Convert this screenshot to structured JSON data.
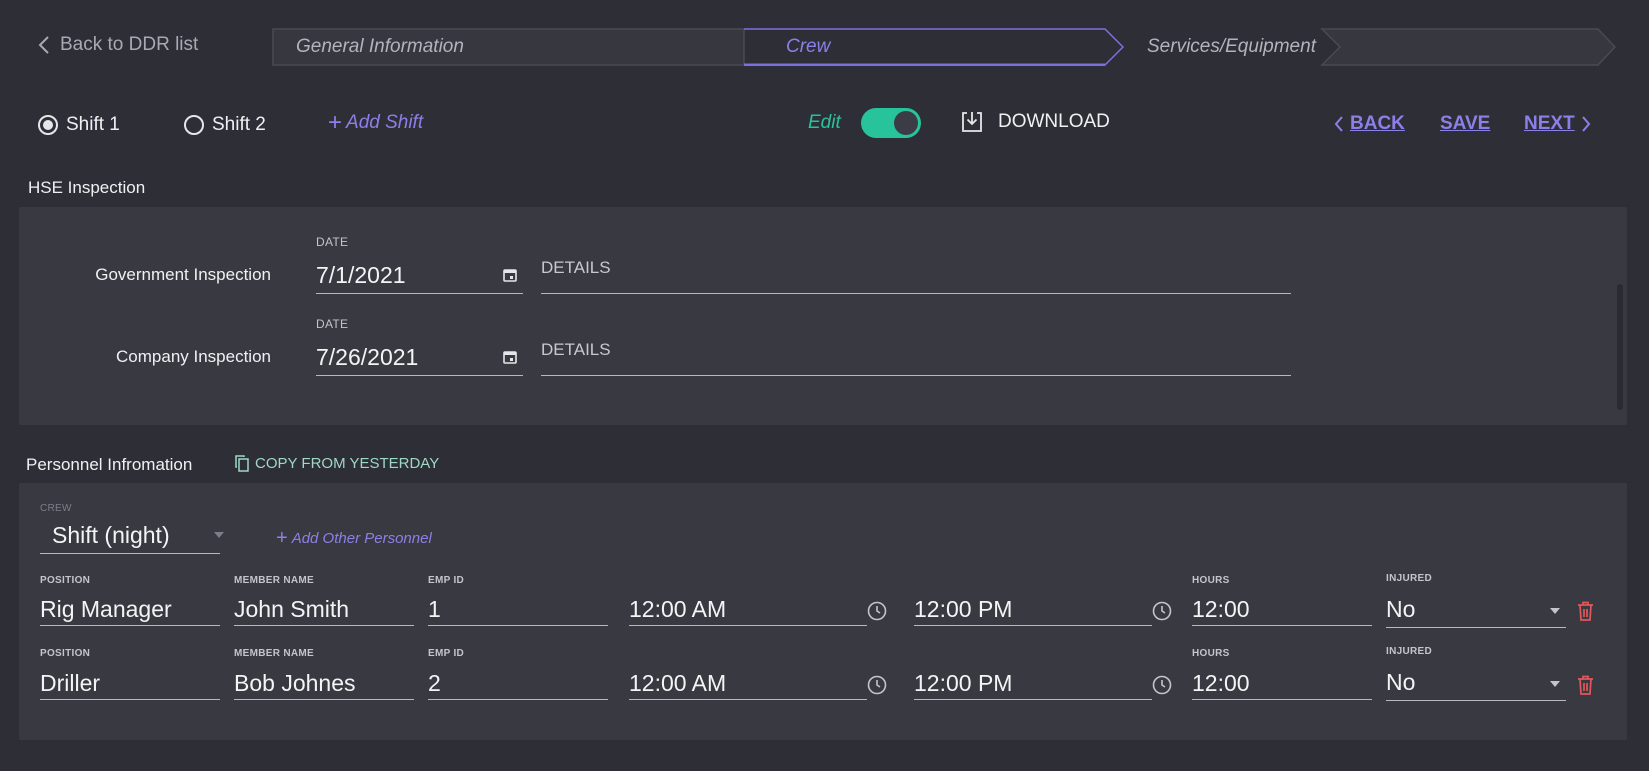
{
  "nav": {
    "back_label": "Back to DDR list",
    "steps": [
      "General Information",
      "Crew",
      "Services/Equipment"
    ],
    "active_step": 1
  },
  "toolbar": {
    "shift1": "Shift 1",
    "shift2": "Shift 2",
    "add_shift": "Add Shift",
    "edit_label": "Edit",
    "edit_on": true,
    "download": "DOWNLOAD",
    "back": "BACK",
    "save": "SAVE",
    "next": "NEXT"
  },
  "hse": {
    "title": "HSE Inspection",
    "rows": [
      {
        "name": "Government Inspection",
        "date_label": "DATE",
        "date": "7/1/2021",
        "details_placeholder": "DETAILS"
      },
      {
        "name": "Company Inspection",
        "date_label": "DATE",
        "date": "7/26/2021",
        "details_placeholder": "DETAILS"
      }
    ]
  },
  "personnel": {
    "title": "Personnel Infromation",
    "copy_label": "COPY FROM YESTERDAY",
    "crew_label": "CREW",
    "crew_value": "Shift (night)",
    "add_other": "Add Other Personnel",
    "labels": {
      "position": "POSITION",
      "member": "MEMBER NAME",
      "emp": "EMP ID",
      "hours": "HOURS",
      "injured": "INJURED"
    },
    "rows": [
      {
        "position": "Rig Manager",
        "member": "John Smith",
        "emp_id": "1",
        "start": "12:00 AM",
        "end": "12:00 PM",
        "hours": "12:00",
        "injured": "No"
      },
      {
        "position": "Driller",
        "member": "Bob Johnes",
        "emp_id": "2",
        "start": "12:00 AM",
        "end": "12:00 PM",
        "hours": "12:00",
        "injured": "No"
      }
    ]
  },
  "colors": {
    "accent": "#8a80e8",
    "success": "#27c39b",
    "danger": "#e0585b",
    "bg": "#2e2e36",
    "panel": "#393941"
  }
}
